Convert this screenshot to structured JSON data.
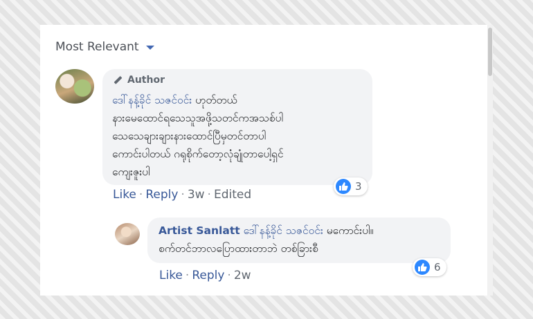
{
  "sort": {
    "label": "Most Relevant"
  },
  "comments": [
    {
      "badge": "Author",
      "mention": "ဒေါ်နန့်ခိုင် သဇင်ဝင်း",
      "text_first": "ဟုတ်တယ်",
      "text_rest": "နားမေထောင်ရသေသူအဖို့သတင်ကအသစ်ပါ\nသေသေချားချားနားထောင်ပြီမှတင်တာပါ\nကောင်းပါတယ် ဂရုစိုက်တော့လုံချုံတာပေါ့ရှင်\nကျေးဇူးပါ",
      "actions": {
        "like": "Like",
        "reply": "Reply",
        "age": "3w",
        "edited": "Edited"
      },
      "reaction_count": "3"
    },
    {
      "author": "Artist Sanlatt",
      "mention": "ဒေါ်နန့်ခိုင် သဇင်ဝင်း",
      "text_first": "မကောင်းပါ။",
      "text_rest": "စက်တင်ဘာလပြောထားတာဘဲ တစ်ခြားစီ",
      "actions": {
        "like": "Like",
        "reply": "Reply",
        "age": "2w"
      },
      "reaction_count": "6"
    }
  ],
  "colors": {
    "link": "#385898",
    "like_blue": "#2d88ff",
    "bubble": "#f2f3f5"
  },
  "icons": {
    "sort": "caret-down-icon",
    "author": "pencil-icon",
    "reaction": "like-icon"
  }
}
